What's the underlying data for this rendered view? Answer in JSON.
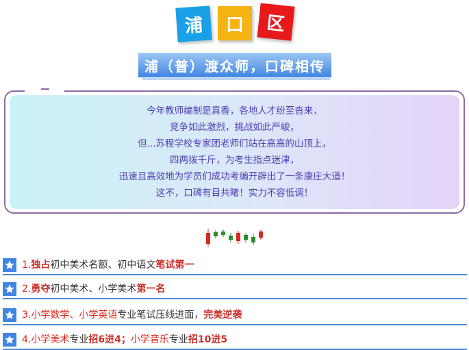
{
  "header": {
    "tiles": [
      {
        "char": "浦",
        "color": "#1aa0e6"
      },
      {
        "char": "口",
        "color": "#f5b314"
      },
      {
        "char": "区",
        "color": "#e8191a"
      }
    ],
    "ribbon_text": "浦（普）渡众师，口碑相传"
  },
  "quote": {
    "lines": [
      "今年教师编制是真香，各地人才纷至沓来，",
      "竞争如此激烈，挑战如此严峻，",
      "但...苏程学校专家团老师们站在高高的山顶上，",
      "四两拨千斤，为考生指点迷津，",
      "迅速且高效地为学员们成功考编开辟出了一条康庄大道！",
      "这不，口碑有目共睹！实力不容低调！"
    ]
  },
  "items": [
    {
      "num": "1.",
      "seg1": "独占",
      "seg2": "初中美术名额、初中语文",
      "seg3": "笔试第一"
    },
    {
      "num": "2.",
      "seg1": "勇夺",
      "seg2": "初中美术、小学美术",
      "seg3": "第一名"
    },
    {
      "num": "3.",
      "seg1": "小学数学、小学英语",
      "seg2": "专业笔试压线进面，",
      "seg3": "完美逆袭"
    },
    {
      "num": "4.",
      "seg1": "小学美术",
      "seg2": "专业",
      "seg3": "招6进4；",
      "seg4": "小学音乐",
      "seg5": "专业",
      "seg6": "招10进5"
    }
  ],
  "colors": {
    "accent_blue": "#3f86e3",
    "highlight_red": "#e1251b",
    "quote_text": "#4a3fb0"
  }
}
